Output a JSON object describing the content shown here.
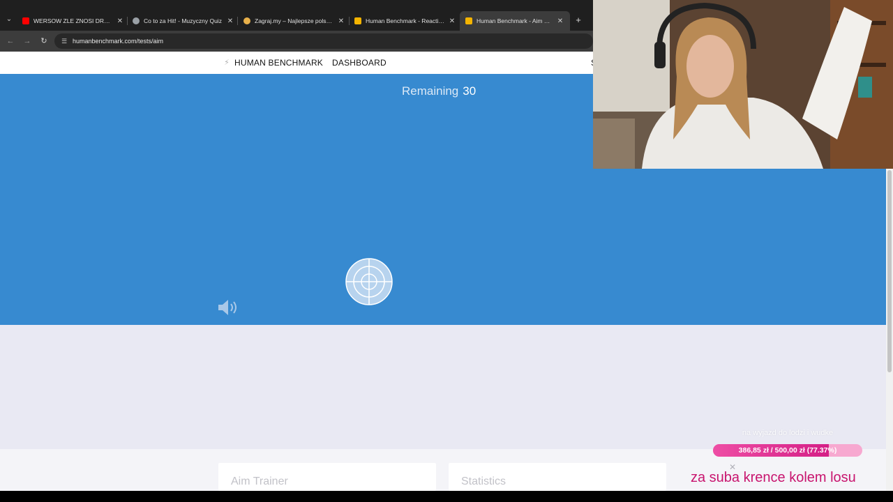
{
  "browser": {
    "tabs": [
      {
        "title": "WERSOW ZLE ZNOSI DRUGA C",
        "favicon": "youtube-icon",
        "favicon_color": "#ff0000",
        "active": false
      },
      {
        "title": "Co to za Hit! - Muzyczny Quiz",
        "favicon": "globe-icon",
        "favicon_color": "#9aa0a6",
        "active": false
      },
      {
        "title": "Zagraj.my – Najlepsze polskie g",
        "favicon": "user-icon",
        "favicon_color": "#e8b04a",
        "active": false
      },
      {
        "title": "Human Benchmark - Reaction T",
        "favicon": "bolt-icon",
        "favicon_color": "#f4b400",
        "active": false
      },
      {
        "title": "Human Benchmark - Aim Traine",
        "favicon": "bolt-icon",
        "favicon_color": "#f4b400",
        "active": true
      }
    ],
    "new_tab_icon": "plus-icon",
    "url": "humanbenchmark.com/tests/aim"
  },
  "site": {
    "brand": "HUMAN BENCHMARK",
    "dashboard": "DASHBOARD",
    "nav_cut_text": "S",
    "accent_color": "#378ad0",
    "remaining_label": "Remaining",
    "remaining_count": "30",
    "target_icon": "crosshair-target-icon",
    "sound_icon": "speaker-icon",
    "cards": [
      {
        "title": "Aim Trainer"
      },
      {
        "title": "Statistics"
      }
    ]
  },
  "overlay": {
    "goal_title": "na wyjazd do lodzi i wudke",
    "goal_text": "386,85 zł / 500,00 zł (77.37%)",
    "goal_fraction": 0.7737,
    "ticker": "za suba krence kolem losu"
  }
}
